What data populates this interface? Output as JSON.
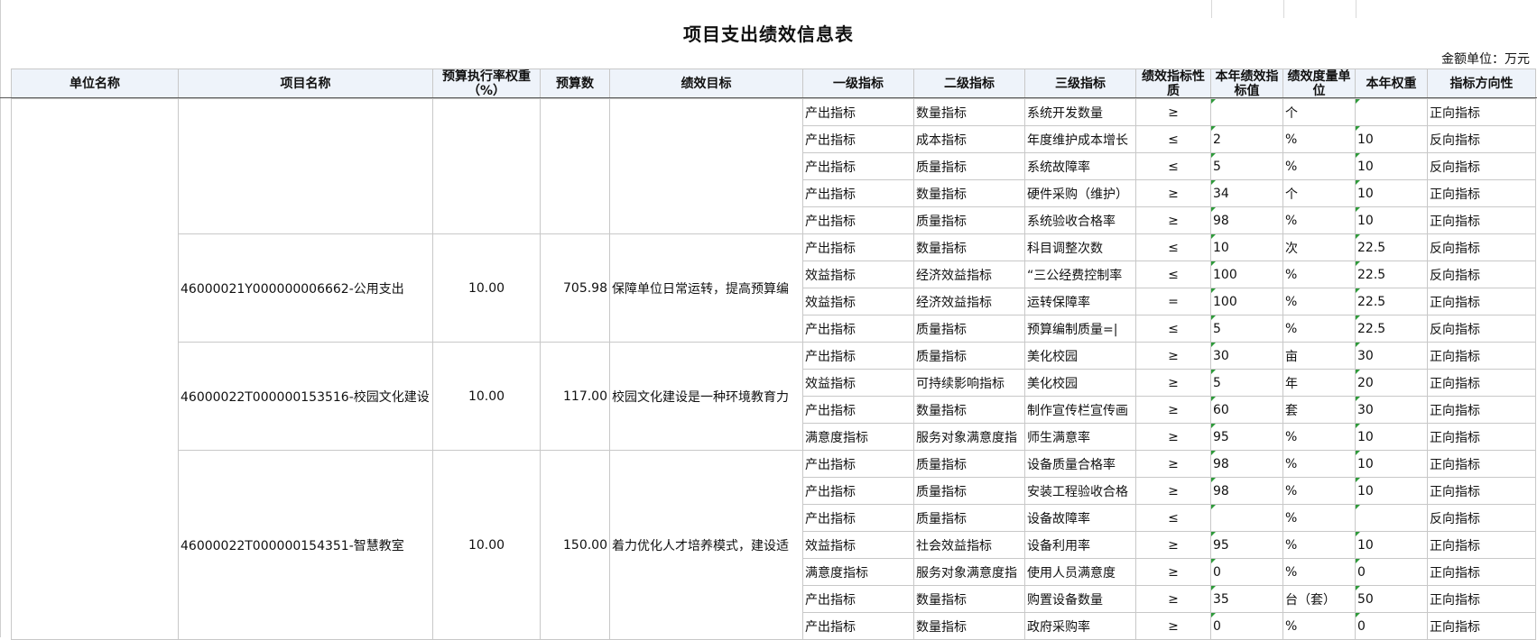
{
  "title": "项目支出绩效信息表",
  "unit_label": "金额单位：万元",
  "headers": [
    "单位名称",
    "项目名称",
    "预算执行率权重（%）",
    "预算数",
    "绩效目标",
    "一级指标",
    "二级指标",
    "三级指标",
    "绩效指标性质",
    "本年绩效指标值",
    "绩效度量单位",
    "本年权重",
    "指标方向性"
  ],
  "projects": [
    {
      "name": "",
      "weight": "",
      "budget": "",
      "goal": "",
      "rows": [
        [
          "产出指标",
          "数量指标",
          "系统开发数量",
          "≥",
          "",
          "个",
          "",
          "正向指标"
        ],
        [
          "产出指标",
          "成本指标",
          "年度维护成本增长",
          "≤",
          "2",
          "%",
          "10",
          "反向指标"
        ],
        [
          "产出指标",
          "质量指标",
          "系统故障率",
          "≤",
          "5",
          "%",
          "10",
          "反向指标"
        ],
        [
          "产出指标",
          "数量指标",
          "硬件采购（维护）",
          "≥",
          "34",
          "个",
          "10",
          "正向指标"
        ],
        [
          "产出指标",
          "质量指标",
          "系统验收合格率",
          "≥",
          "98",
          "%",
          "10",
          "正向指标"
        ]
      ]
    },
    {
      "name": "46000021Y000000006662-公用支出",
      "weight": "10.00",
      "budget": "705.98",
      "goal": "保障单位日常运转，提高预算编",
      "rows": [
        [
          "产出指标",
          "数量指标",
          "科目调整次数",
          "≤",
          "10",
          "次",
          "22.5",
          "反向指标"
        ],
        [
          "效益指标",
          "经济效益指标",
          "“三公经费控制率",
          "≤",
          "100",
          "%",
          "22.5",
          "反向指标"
        ],
        [
          "效益指标",
          "经济效益指标",
          "运转保障率",
          "=",
          "100",
          "%",
          "22.5",
          "正向指标"
        ],
        [
          "产出指标",
          "质量指标",
          "预算编制质量=|",
          "≤",
          "5",
          "%",
          "22.5",
          "反向指标"
        ]
      ]
    },
    {
      "name": "46000022T000000153516-校园文化建设",
      "weight": "10.00",
      "budget": "117.00",
      "goal": "校园文化建设是一种环境教育力",
      "rows": [
        [
          "产出指标",
          "质量指标",
          "美化校园",
          "≥",
          "30",
          "亩",
          "30",
          "正向指标"
        ],
        [
          "效益指标",
          "可持续影响指标",
          "美化校园",
          "≥",
          "5",
          "年",
          "20",
          "正向指标"
        ],
        [
          "产出指标",
          "数量指标",
          "制作宣传栏宣传画",
          "≥",
          "60",
          "套",
          "30",
          "正向指标"
        ],
        [
          "满意度指标",
          "服务对象满意度指",
          "师生满意率",
          "≥",
          "95",
          "%",
          "10",
          "正向指标"
        ]
      ]
    },
    {
      "name": "46000022T000000154351-智慧教室",
      "weight": "10.00",
      "budget": "150.00",
      "goal": "着力优化人才培养模式，建设适",
      "rows": [
        [
          "产出指标",
          "质量指标",
          "设备质量合格率",
          "≥",
          "98",
          "%",
          "10",
          "正向指标"
        ],
        [
          "产出指标",
          "质量指标",
          "安装工程验收合格",
          "≥",
          "98",
          "%",
          "10",
          "正向指标"
        ],
        [
          "产出指标",
          "质量指标",
          "设备故障率",
          "≤",
          "",
          "%",
          "",
          "反向指标"
        ],
        [
          "效益指标",
          "社会效益指标",
          "设备利用率",
          "≥",
          "95",
          "%",
          "10",
          "正向指标"
        ],
        [
          "满意度指标",
          "服务对象满意度指",
          "使用人员满意度",
          "≥",
          "0",
          "%",
          "0",
          "正向指标"
        ],
        [
          "产出指标",
          "数量指标",
          "购置设备数量",
          "≥",
          "35",
          "台（套）",
          "50",
          "正向指标"
        ],
        [
          "产出指标",
          "数量指标",
          "政府采购率",
          "≥",
          "0",
          "%",
          "0",
          "正向指标"
        ]
      ]
    }
  ]
}
